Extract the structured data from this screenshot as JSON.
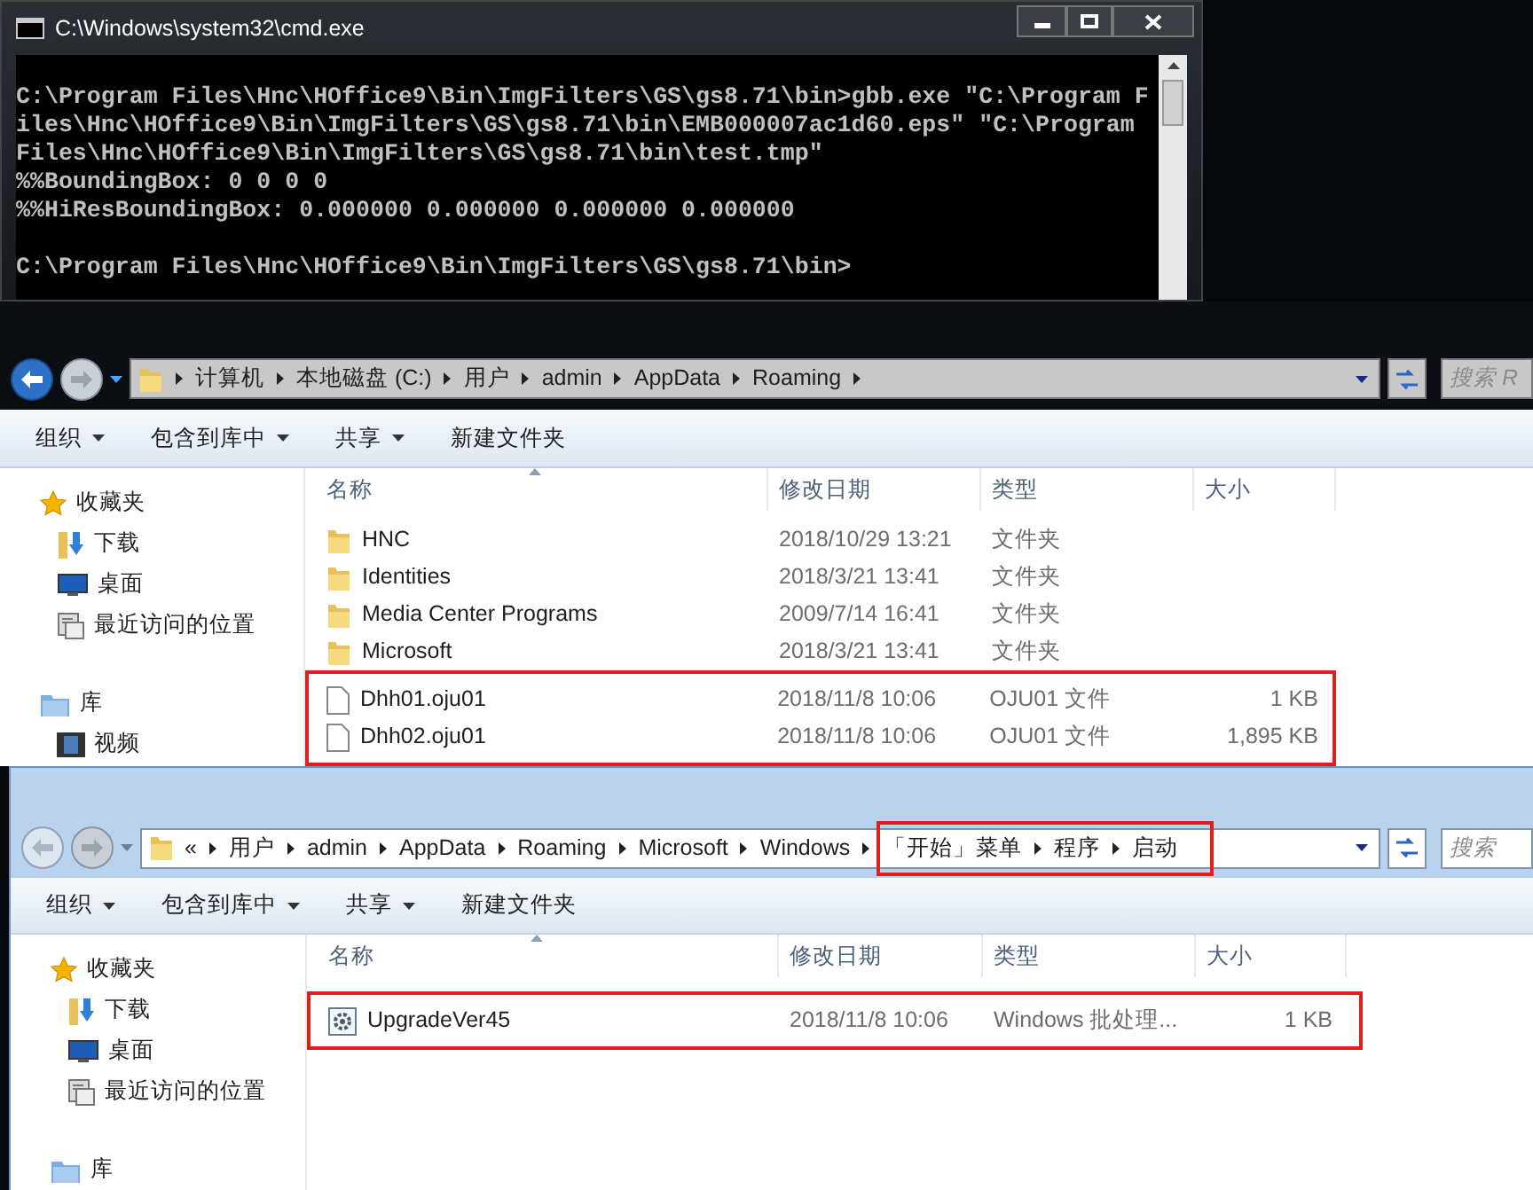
{
  "cmd_window": {
    "title": "C:\\Windows\\system32\\cmd.exe",
    "lines": [
      "C:\\Program Files\\Hnc\\HOffice9\\Bin\\ImgFilters\\GS\\gs8.71\\bin>gbb.exe \"C:\\Program F",
      "iles\\Hnc\\HOffice9\\Bin\\ImgFilters\\GS\\gs8.71\\bin\\EMB000007ac1d60.eps\" \"C:\\Program",
      "Files\\Hnc\\HOffice9\\Bin\\ImgFilters\\GS\\gs8.71\\bin\\test.tmp\"",
      "%%BoundingBox: 0 0 0 0",
      "%%HiResBoundingBox: 0.000000 0.000000 0.000000 0.000000",
      "C:\\Program Files\\Hnc\\HOffice9\\Bin\\ImgFilters\\GS\\gs8.71\\bin>"
    ]
  },
  "explorers": [
    {
      "breadcrumb": [
        {
          "label": "计算机",
          "highlighted": false
        },
        {
          "label": "本地磁盘 (C:)",
          "highlighted": false
        },
        {
          "label": "用户",
          "highlighted": false
        },
        {
          "label": "admin",
          "highlighted": false
        },
        {
          "label": "AppData",
          "highlighted": false
        },
        {
          "label": "Roaming",
          "highlighted": false
        }
      ],
      "search": {
        "placeholder": "搜索 R"
      },
      "toolbar": [
        {
          "label": "组织",
          "dropdown": true
        },
        {
          "label": "包含到库中",
          "dropdown": true
        },
        {
          "label": "共享",
          "dropdown": true
        },
        {
          "label": "新建文件夹",
          "dropdown": false
        }
      ],
      "sidebar": [
        {
          "label": "收藏夹",
          "kind": "favorites"
        },
        {
          "label": "下载",
          "kind": "downloads"
        },
        {
          "label": "桌面",
          "kind": "desktop"
        },
        {
          "label": "最近访问的位置",
          "kind": "recent"
        },
        {
          "label": "库",
          "kind": "library"
        },
        {
          "label": "视频",
          "kind": "videos"
        }
      ],
      "columns": [
        "名称",
        "修改日期",
        "类型",
        "大小"
      ],
      "files": [
        {
          "name": "HNC",
          "date": "2018/10/29 13:21",
          "type": "文件夹",
          "kind": "folder",
          "highlighted": false
        },
        {
          "name": "Identities",
          "date": "2018/3/21 13:41",
          "type": "文件夹",
          "kind": "folder",
          "highlighted": false
        },
        {
          "name": "Media Center Programs",
          "date": "2009/7/14 16:41",
          "type": "文件夹",
          "kind": "folder",
          "highlighted": false
        },
        {
          "name": "Microsoft",
          "date": "2018/3/21 13:41",
          "type": "文件夹",
          "kind": "folder",
          "highlighted": false
        },
        {
          "name": "Dhh01.oju01",
          "date": "2018/11/8 10:06",
          "type": "OJU01 文件",
          "size": "1 KB",
          "kind": "file",
          "highlighted": true
        },
        {
          "name": "Dhh02.oju01",
          "date": "2018/11/8 10:06",
          "type": "OJU01 文件",
          "size": "1,895 KB",
          "kind": "file",
          "highlighted": true
        }
      ]
    },
    {
      "overflow": "«",
      "breadcrumb": [
        {
          "label": "用户",
          "highlighted": false
        },
        {
          "label": "admin",
          "highlighted": false
        },
        {
          "label": "AppData",
          "highlighted": false
        },
        {
          "label": "Roaming",
          "highlighted": false
        },
        {
          "label": "Microsoft",
          "highlighted": false
        },
        {
          "label": "Windows",
          "highlighted": false
        },
        {
          "label": "「开始」菜单",
          "highlighted": true
        },
        {
          "label": "程序",
          "highlighted": true
        },
        {
          "label": "启动",
          "highlighted": true
        }
      ],
      "search": {
        "placeholder": "搜索"
      },
      "toolbar": [
        {
          "label": "组织",
          "dropdown": true
        },
        {
          "label": "包含到库中",
          "dropdown": true
        },
        {
          "label": "共享",
          "dropdown": true
        },
        {
          "label": "新建文件夹",
          "dropdown": false
        }
      ],
      "sidebar": [
        {
          "label": "收藏夹",
          "kind": "favorites"
        },
        {
          "label": "下载",
          "kind": "downloads"
        },
        {
          "label": "桌面",
          "kind": "desktop"
        },
        {
          "label": "最近访问的位置",
          "kind": "recent"
        },
        {
          "label": "库",
          "kind": "library"
        }
      ],
      "columns": [
        "名称",
        "修改日期",
        "类型",
        "大小"
      ],
      "files": [
        {
          "name": "UpgradeVer45",
          "date": "2018/11/8 10:06",
          "type": "Windows 批处理...",
          "size": "1 KB",
          "kind": "batch",
          "highlighted": true
        }
      ]
    }
  ]
}
